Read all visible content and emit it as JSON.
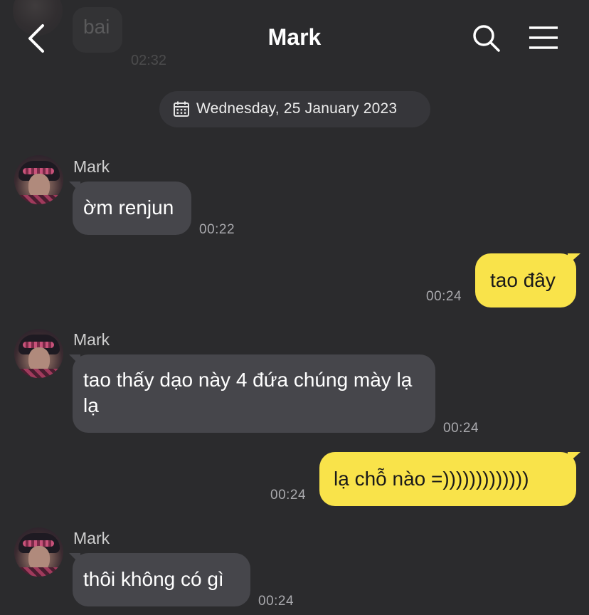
{
  "header": {
    "title": "Mark",
    "back_icon": "chevron-left-icon",
    "search_icon": "search-icon",
    "menu_icon": "menu-icon"
  },
  "previous_message": {
    "text": "bai",
    "time": "02:32"
  },
  "date_separator": {
    "icon": "calendar-icon",
    "label": "Wednesday, 25 January 2023"
  },
  "messages": [
    {
      "direction": "incoming",
      "sender": "Mark",
      "text": "ờm renjun",
      "time": "00:22"
    },
    {
      "direction": "outgoing",
      "text": "tao đây",
      "time": "00:24"
    },
    {
      "direction": "incoming",
      "sender": "Mark",
      "text": "tao thấy dạo này 4 đứa chúng mày lạ lạ",
      "time": "00:24"
    },
    {
      "direction": "outgoing",
      "text": "lạ chỗ nào =)))))))))))))",
      "time": "00:24"
    },
    {
      "direction": "incoming",
      "sender": "Mark",
      "text": "thôi không có gì",
      "time": "00:24"
    }
  ],
  "colors": {
    "background": "#2b2b2d",
    "incoming_bubble": "#46464b",
    "outgoing_bubble": "#f9e34a"
  }
}
